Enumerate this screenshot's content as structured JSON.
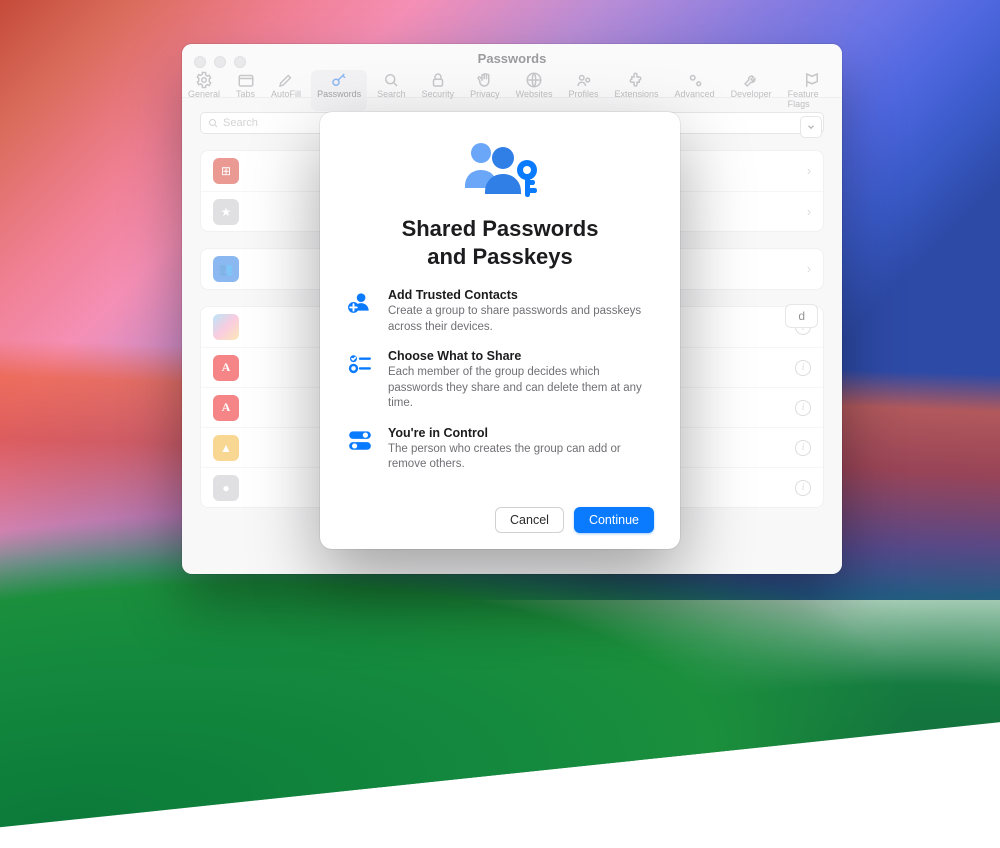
{
  "window": {
    "title": "Passwords",
    "toolbar": [
      {
        "id": "general",
        "label": "General"
      },
      {
        "id": "tabs",
        "label": "Tabs"
      },
      {
        "id": "autofill",
        "label": "AutoFill"
      },
      {
        "id": "passwords",
        "label": "Passwords"
      },
      {
        "id": "search",
        "label": "Search"
      },
      {
        "id": "security",
        "label": "Security"
      },
      {
        "id": "privacy",
        "label": "Privacy"
      },
      {
        "id": "websites",
        "label": "Websites"
      },
      {
        "id": "profiles",
        "label": "Profiles"
      },
      {
        "id": "extensions",
        "label": "Extensions"
      },
      {
        "id": "advanced",
        "label": "Advanced"
      },
      {
        "id": "developer",
        "label": "Developer"
      },
      {
        "id": "featureflags",
        "label": "Feature Flags"
      }
    ],
    "selected_toolbar": "passwords",
    "search_placeholder": "Search",
    "pill_hint": "d"
  },
  "modal": {
    "title_line1": "Shared Passwords",
    "title_line2": "and Passkeys",
    "features": [
      {
        "id": "add-contacts",
        "title": "Add Trusted Contacts",
        "body": "Create a group to share passwords and passkeys across their devices."
      },
      {
        "id": "choose-share",
        "title": "Choose What to Share",
        "body": "Each member of the group decides which passwords they share and can delete them at any time."
      },
      {
        "id": "in-control",
        "title": "You're in Control",
        "body": "The person who creates the group can add or remove others."
      }
    ],
    "cancel_label": "Cancel",
    "continue_label": "Continue"
  },
  "colors": {
    "accent": "#0a7aff",
    "hero_blue": "#3b82f6"
  }
}
